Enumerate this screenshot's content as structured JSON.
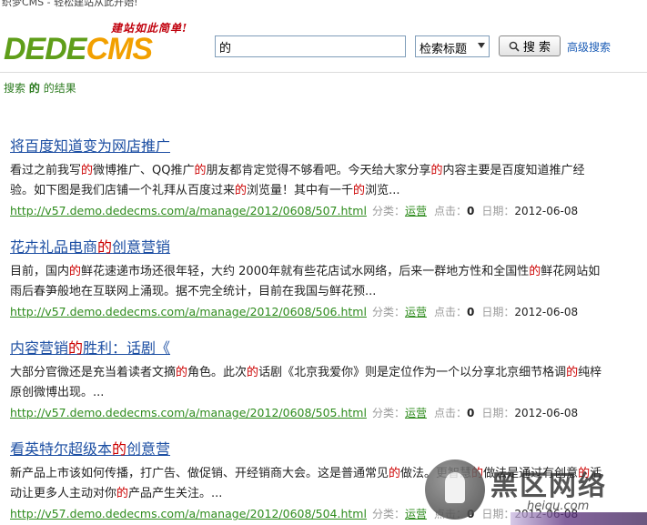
{
  "window": {
    "title": "织梦CMS - 轻松建站从此开始!"
  },
  "header": {
    "logo_slogan": "建站如此简单!",
    "logo_part1": "DEDE",
    "logo_part2": "CMS",
    "search_value": "的",
    "search_scope": "检索标题",
    "search_button_label": "搜 索",
    "advanced_search_label": "高级搜索"
  },
  "breadcrumb": {
    "prefix": "搜索",
    "keyword": "的",
    "suffix": "的结果"
  },
  "meta_labels": {
    "category": "分类：",
    "clicks": "点击：",
    "date": "日期："
  },
  "results": [
    {
      "title": [
        {
          "t": "将百度知道变为网店推广",
          "hl": false
        }
      ],
      "desc": [
        {
          "t": "看过之前我写",
          "hl": false
        },
        {
          "t": "的",
          "hl": true
        },
        {
          "t": "微博推广、QQ推广",
          "hl": false
        },
        {
          "t": "的",
          "hl": true
        },
        {
          "t": "朋友都肯定觉得不够看吧。今天给大家分享",
          "hl": false
        },
        {
          "t": "的",
          "hl": true
        },
        {
          "t": "内容主要是百度知道推广经验。如下图是我们店铺一个礼拜从百度过来",
          "hl": false
        },
        {
          "t": "的",
          "hl": true
        },
        {
          "t": "浏览量！其中有一千",
          "hl": false
        },
        {
          "t": "的",
          "hl": true
        },
        {
          "t": "浏览...",
          "hl": false
        }
      ],
      "url": "http://v57.demo.dedecms.com/a/manage/2012/0608/507.html",
      "category": "运营",
      "clicks": "0",
      "date": "2012-06-08"
    },
    {
      "title": [
        {
          "t": "花卉礼品电商",
          "hl": false
        },
        {
          "t": "的",
          "hl": true
        },
        {
          "t": "创意营销",
          "hl": false
        }
      ],
      "desc": [
        {
          "t": "目前，国内",
          "hl": false
        },
        {
          "t": "的",
          "hl": true
        },
        {
          "t": "鲜花速递市场还很年轻，大约 2000年就有些花店试水网络，后来一群地方性和全国性",
          "hl": false
        },
        {
          "t": "的",
          "hl": true
        },
        {
          "t": "鲜花网站如雨后春笋般地在互联网上涌现。据不完全统计，目前在我国与鲜花预...",
          "hl": false
        }
      ],
      "url": "http://v57.demo.dedecms.com/a/manage/2012/0608/506.html",
      "category": "运营",
      "clicks": "0",
      "date": "2012-06-08"
    },
    {
      "title": [
        {
          "t": "内容营销",
          "hl": false
        },
        {
          "t": "的",
          "hl": true
        },
        {
          "t": "胜利：话剧《",
          "hl": false
        }
      ],
      "desc": [
        {
          "t": "大部分官微还是充当着读者文摘",
          "hl": false
        },
        {
          "t": "的",
          "hl": true
        },
        {
          "t": "角色。此次",
          "hl": false
        },
        {
          "t": "的",
          "hl": true
        },
        {
          "t": "话剧《北京我爱你》则是定位作为一个以分享北京细节格调",
          "hl": false
        },
        {
          "t": "的",
          "hl": true
        },
        {
          "t": "纯梓原创微博出现。...",
          "hl": false
        }
      ],
      "url": "http://v57.demo.dedecms.com/a/manage/2012/0608/505.html",
      "category": "运营",
      "clicks": "0",
      "date": "2012-06-08"
    },
    {
      "title": [
        {
          "t": "看英特尔超级本",
          "hl": false
        },
        {
          "t": "的",
          "hl": true
        },
        {
          "t": "创意营",
          "hl": false
        }
      ],
      "desc": [
        {
          "t": "新产品上市该如何传播，打广告、做促销、开经销商大会。这是普通常见",
          "hl": false
        },
        {
          "t": "的",
          "hl": true
        },
        {
          "t": "做法。更智慧",
          "hl": false
        },
        {
          "t": "的",
          "hl": true
        },
        {
          "t": "做法是通过有创意",
          "hl": false
        },
        {
          "t": "的",
          "hl": true
        },
        {
          "t": "活动让更多人主动对你",
          "hl": false
        },
        {
          "t": "的",
          "hl": true
        },
        {
          "t": "产品产生关注。...",
          "hl": false
        }
      ],
      "url": "http://v57.demo.dedecms.com/a/manage/2012/0608/504.html",
      "category": "运营",
      "clicks": "0",
      "date": "2012-06-08"
    }
  ],
  "watermark": {
    "text": "黑区网络",
    "sub": "heiqu.com"
  },
  "colors": {
    "link": "#1d4fa3",
    "highlight": "#cc0000",
    "url_green": "#2d8b1c",
    "logo_green": "#5f9e1a",
    "logo_orange": "#f2a000"
  }
}
